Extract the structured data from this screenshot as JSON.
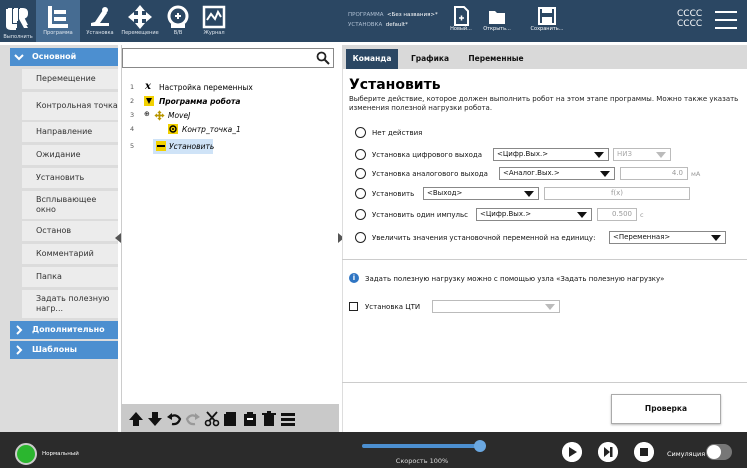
{
  "header": {
    "tabs": [
      {
        "label": "Выполнить",
        "icon": "robot-run-icon"
      },
      {
        "label": "Программа",
        "icon": "program-icon"
      },
      {
        "label": "Установка",
        "icon": "installation-icon"
      },
      {
        "label": "Перемещение",
        "icon": "move-icon"
      },
      {
        "label": "В/В",
        "icon": "io-icon"
      },
      {
        "label": "Журнал",
        "icon": "log-icon"
      }
    ],
    "program_label": "ПРОГРАММА",
    "program_value": "<Без названия>*",
    "installation_label": "УСТАНОВКА",
    "installation_value": "default*",
    "file_buttons": [
      {
        "label": "Новый...",
        "icon": "new-file-icon"
      },
      {
        "label": "Открыть...",
        "icon": "open-folder-icon"
      },
      {
        "label": "Сохранить...",
        "icon": "save-icon"
      }
    ],
    "cccc_1": "CCCC",
    "cccc_2": "CCCC"
  },
  "sidebar": {
    "sections": [
      {
        "label": "Основной",
        "expanded": true
      },
      {
        "label": "Дополнительно",
        "expanded": false
      },
      {
        "label": "Шаблоны",
        "expanded": false
      }
    ],
    "items": [
      "Перемещение",
      "Контрольная точка",
      "Направление",
      "Ожидание",
      "Установить",
      "Всплывающее окно",
      "Останов",
      "Комментарий",
      "Папка",
      "Задать полезную нагр..."
    ]
  },
  "tree": {
    "nodes": [
      {
        "num": "1",
        "icon": "variables-icon",
        "label": "Настройка переменных"
      },
      {
        "num": "2",
        "icon": "program-triangle-icon",
        "label": "Программа робота"
      },
      {
        "num": "3",
        "icon": "move-icon",
        "label": "MoveJ"
      },
      {
        "num": "4",
        "icon": "waypoint-icon",
        "label": "Контр_точка_1"
      },
      {
        "num": "5",
        "icon": "set-icon",
        "label": "Установить"
      }
    ]
  },
  "right": {
    "tabs": [
      "Команда",
      "Графика",
      "Переменные"
    ],
    "title": "Установить",
    "description": "Выберите действие, которое должен выполнить робот на этом этапе программы. Можно также указать изменения полезной нагрузки робота.",
    "options": {
      "none": "Нет действия",
      "digital": "Установка цифрового выхода",
      "digital_dd": "<Цифр.Вых.>",
      "digital_val": "НИЗ",
      "analog": "Установка аналогового выхода",
      "analog_dd": "<Аналог.Вых.>",
      "analog_val": "4.0",
      "analog_unit": "мА",
      "set": "Установить",
      "set_dd": "<Выход>",
      "set_expr": "f(x)",
      "pulse": "Установить один импульс",
      "pulse_dd": "<Цифр.Вых.>",
      "pulse_val": "0.500",
      "pulse_unit": "с",
      "increment": "Увеличить значения установочной переменной на единицу:",
      "increment_dd": "<Переменная>"
    },
    "payload_info": "Задать полезную нагрузку можно с помощью узла «Задать полезную нагрузку»",
    "tcp_label": "Установка ЦТИ",
    "check_button": "Проверка"
  },
  "footer": {
    "status": "Нормальный",
    "speed": "Скорость 100%",
    "speed_percent": 100,
    "simulation": "Симуляция"
  }
}
